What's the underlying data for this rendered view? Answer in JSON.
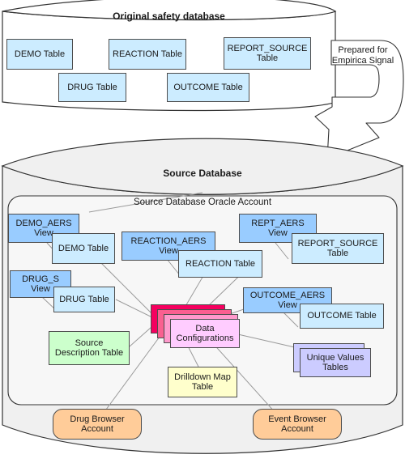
{
  "top_cylinder": {
    "title": "Original safety database",
    "tables": [
      {
        "label": "DEMO Table"
      },
      {
        "label": "REACTION Table"
      },
      {
        "label": "REPORT_SOURCE\nTable"
      },
      {
        "label": "DRUG Table"
      },
      {
        "label": "OUTCOME Table"
      }
    ]
  },
  "arrow": {
    "label": "Prepared for\nEmpirica Signal"
  },
  "bottom_cylinder": {
    "title": "Source Database",
    "inner_title": "Source Database Oracle Account",
    "views": [
      {
        "label": "DEMO_AERS\nView"
      },
      {
        "label": "REACTION_AERS\nView"
      },
      {
        "label": "REPT_AERS\nView"
      },
      {
        "label": "DRUG_S\nView"
      },
      {
        "label": "OUTCOME_AERS\nView"
      }
    ],
    "tables": [
      {
        "label": "DEMO Table"
      },
      {
        "label": "REACTION Table"
      },
      {
        "label": "REPORT_SOURCE\nTable"
      },
      {
        "label": "DRUG Table"
      },
      {
        "label": "OUTCOME Table"
      }
    ],
    "hub": {
      "label": "Data\nConfigurations"
    },
    "source_description": {
      "label": "Source\nDescription Table"
    },
    "drilldown_map": {
      "label": "Drilldown Map\nTable"
    },
    "unique_values": {
      "label": "Unique Values\nTables"
    },
    "accounts": [
      {
        "label": "Drug Browser\nAccount"
      },
      {
        "label": "Event Browser\nAccount"
      }
    ]
  },
  "colors": {
    "view_fill": "#99CCFF",
    "table_fill": "#CCECFF",
    "hub_front": "#FFCCFF",
    "hub_back": "#F5005F",
    "green_fill": "#CCFFCC",
    "yellow_fill": "#FFFFCC",
    "purple_fill": "#CCCCFF",
    "orange_fill": "#FFCC99",
    "cylinder_fill": "#F0F0F0",
    "stroke": "#333333"
  }
}
